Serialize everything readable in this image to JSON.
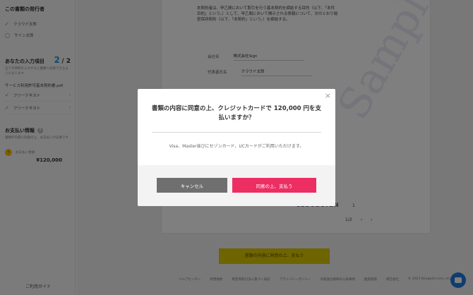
{
  "sidebar": {
    "doc_type_title": "この書類の発行者",
    "doc_types": [
      {
        "label": "クラウド太郎",
        "checked": true
      },
      {
        "label": "サイン太郎",
        "checked": false
      }
    ],
    "input_title": "あなたの入力項目",
    "input_count": "2",
    "input_total": "2",
    "input_note": "全ての項目を入力すると書類へ同意できるようになります",
    "doc_name": "サービス利用許可基本契約書.pdf",
    "free_items": [
      {
        "label": "フリーテキスト"
      },
      {
        "label": "フリーテキスト"
      }
    ],
    "pay_title": "お支払い情報",
    "pay_note": "書類の内容に同意の上、お支払いが必要です",
    "pay_label": "お支払い金額",
    "pay_amount": "¥120,000",
    "guide": "ご利用ガイド"
  },
  "document": {
    "body_text": "本契約者は、甲乙間において取引を行う基本契約を締結する目的（以下、「本件目的」という。）として、甲乙間において開示される情報について、次のとおり秘密保持契約（以下、「本契約」という。）を締結する。",
    "fields": [
      {
        "label": "会社名",
        "value": "株式会社Sign"
      },
      {
        "label": "代表者氏名",
        "value": "クラウド太郎"
      }
    ],
    "watermark": "Sample",
    "logo": "CLOUDSIGN",
    "page_num": "1",
    "pager": "1/2",
    "agree_button": "書類の内容に同意の上、支払う"
  },
  "footer": {
    "links": [
      "ヘルプセンター",
      "利用規約",
      "特定商取引法に基づく表記",
      "プライバシーポリシー",
      "外部送信規律の公表事項",
      "推奨環境",
      "運営会社",
      "© 2023 Bengoshi.com, Inc."
    ]
  },
  "modal": {
    "title": "書類の内容に同意の上、クレジットカードで 120,000 円を支払いますか？",
    "note": "Visa、Master並びにセゾンカード、UCカードがご利用いただけます。",
    "cancel_label": "キャンセル",
    "pay_label": "同意の上、支払う",
    "close_label": "×"
  },
  "colors": {
    "pay_button": "#ec2e63",
    "cancel_button": "#6f6f6f",
    "chat_button": "#1f7ae0"
  }
}
